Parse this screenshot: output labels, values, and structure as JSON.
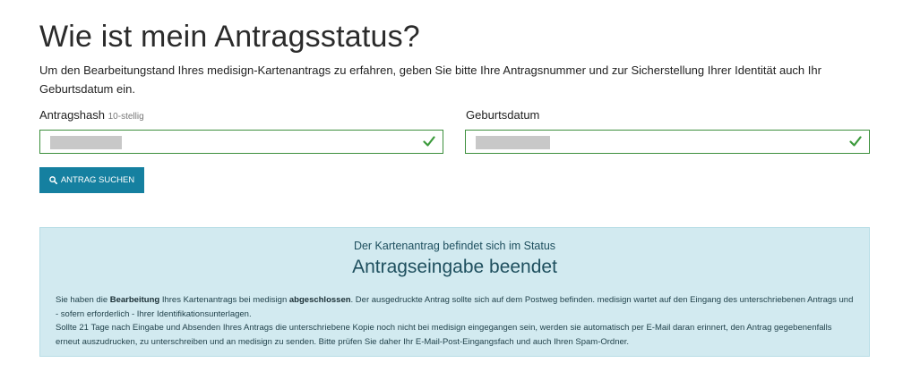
{
  "page": {
    "title": "Wie ist mein Antragsstatus?",
    "intro": "Um den Bearbeitungstand Ihres medisign-Kartenantrags zu erfahren, geben Sie bitte Ihre Antragsnummer und zur Sicherstellung Ihrer Identität auch Ihr Geburtsdatum ein."
  },
  "form": {
    "hash_label": "Antragshash",
    "hash_hint": "10-stellig",
    "hash_value": "",
    "birthdate_label": "Geburtsdatum",
    "birthdate_value": "",
    "search_button": "Antrag suchen"
  },
  "status": {
    "intro": "Der Kartenantrag befindet sich im Status",
    "value": "Antragseingabe beendet",
    "desc_part1": "Sie haben die ",
    "desc_bold1": "Bearbeitung",
    "desc_part2": " Ihres Kartenantrags bei medisign ",
    "desc_bold2": "abgeschlossen",
    "desc_part3": ". Der ausgedruckte Antrag sollte sich auf dem Postweg befinden. medisign wartet auf den Eingang des unterschriebenen Antrags und - sofern erforderlich - Ihrer Identifikationsunterlagen.",
    "desc_part4": "Sollte 21 Tage nach Eingabe und Absenden Ihres Antrags die unterschriebene Kopie noch nicht bei medisign eingegangen sein, werden sie automatisch per E-Mail daran erinnert, den Antrag gegebenenfalls erneut auszudrucken, zu unterschreiben und an medisign zu senden. Bitte prüfen Sie daher Ihr E-Mail-Post-Eingangsfach und auch Ihren Spam-Ordner."
  },
  "icons": {
    "search": "search-icon",
    "valid": "check-icon"
  },
  "colors": {
    "valid_border": "#3c8f3c",
    "button": "#1580a0",
    "status_background": "#d2eaf0",
    "status_text": "#1e4f5e"
  }
}
